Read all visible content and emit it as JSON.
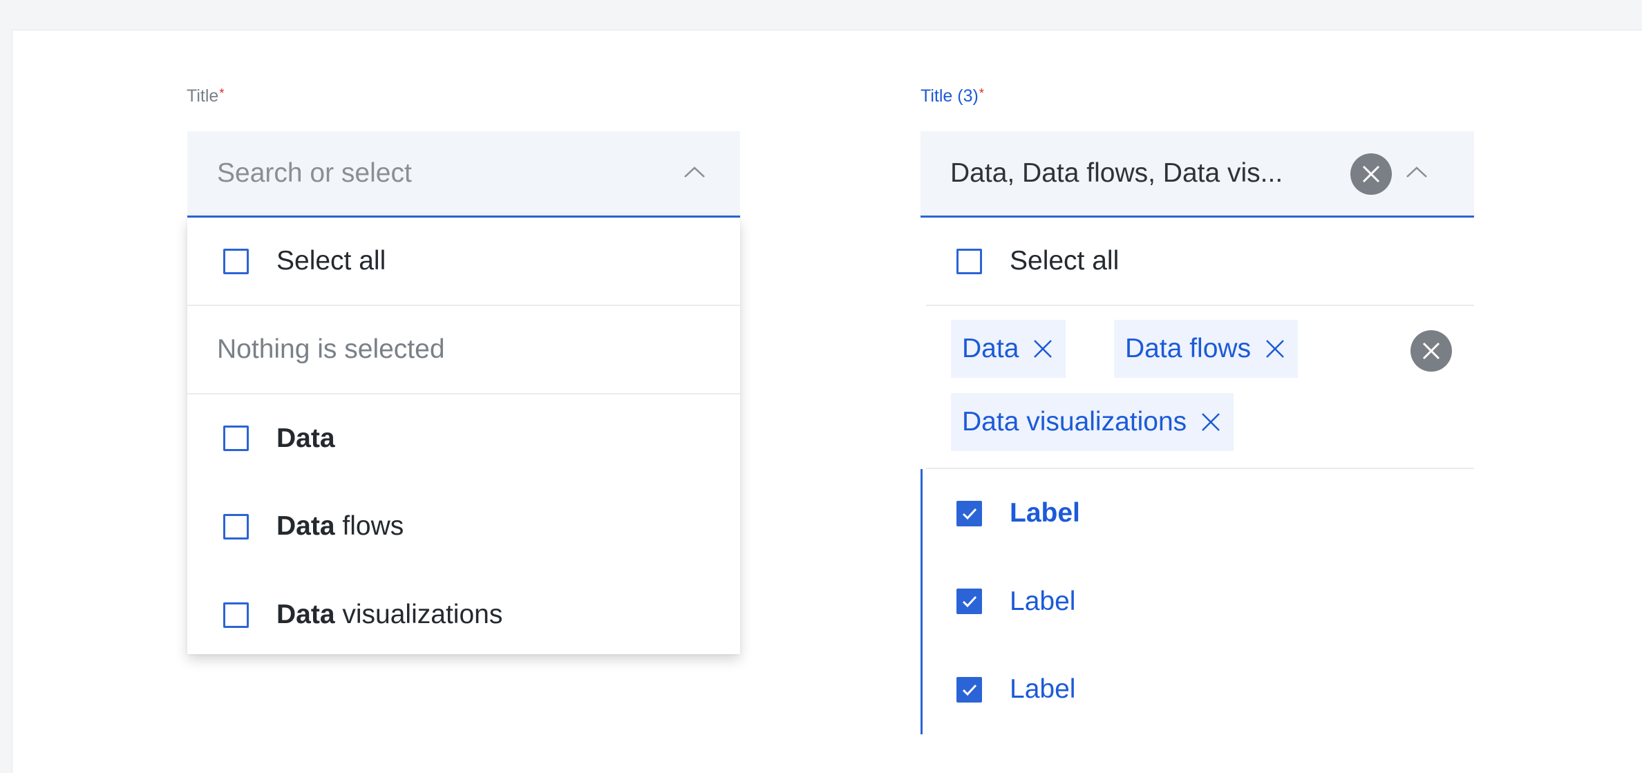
{
  "left": {
    "label": "Title",
    "required_mark": "*",
    "placeholder": "Search or select",
    "chevron_icon": "chevron-up-icon",
    "select_all": "Select all",
    "empty_text": "Nothing is selected",
    "options": [
      {
        "match": "Data",
        "rest": ""
      },
      {
        "match": "Data",
        "rest": " flows"
      },
      {
        "match": "Data",
        "rest": " visualizations"
      }
    ]
  },
  "right": {
    "label": "Title (3)",
    "required_mark": "*",
    "value": "Data, Data flows, Data vis...",
    "clear_icon": "clear-circle-icon",
    "chevron_icon": "chevron-up-icon",
    "select_all": "Select all",
    "chips": [
      "Data",
      "Data flows",
      "Data visualizations"
    ],
    "options": [
      {
        "label": "Label",
        "checked": true
      },
      {
        "label": "Label",
        "checked": true
      },
      {
        "label": "Label",
        "checked": true
      }
    ]
  },
  "colors": {
    "accent": "#2b64d6",
    "required": "#e0252e",
    "field_bg": "#f2f5f9",
    "chip_bg": "#eef3fd"
  }
}
